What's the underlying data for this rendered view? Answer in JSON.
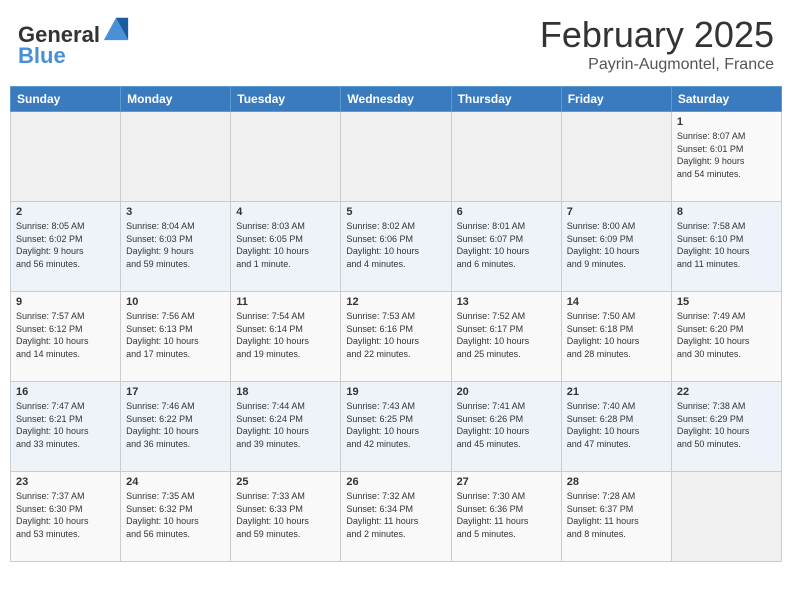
{
  "header": {
    "logo_general": "General",
    "logo_blue": "Blue",
    "month_title": "February 2025",
    "location": "Payrin-Augmontel, France"
  },
  "weekdays": [
    "Sunday",
    "Monday",
    "Tuesday",
    "Wednesday",
    "Thursday",
    "Friday",
    "Saturday"
  ],
  "weeks": [
    [
      {
        "day": "",
        "info": ""
      },
      {
        "day": "",
        "info": ""
      },
      {
        "day": "",
        "info": ""
      },
      {
        "day": "",
        "info": ""
      },
      {
        "day": "",
        "info": ""
      },
      {
        "day": "",
        "info": ""
      },
      {
        "day": "1",
        "info": "Sunrise: 8:07 AM\nSunset: 6:01 PM\nDaylight: 9 hours\nand 54 minutes."
      }
    ],
    [
      {
        "day": "2",
        "info": "Sunrise: 8:05 AM\nSunset: 6:02 PM\nDaylight: 9 hours\nand 56 minutes."
      },
      {
        "day": "3",
        "info": "Sunrise: 8:04 AM\nSunset: 6:03 PM\nDaylight: 9 hours\nand 59 minutes."
      },
      {
        "day": "4",
        "info": "Sunrise: 8:03 AM\nSunset: 6:05 PM\nDaylight: 10 hours\nand 1 minute."
      },
      {
        "day": "5",
        "info": "Sunrise: 8:02 AM\nSunset: 6:06 PM\nDaylight: 10 hours\nand 4 minutes."
      },
      {
        "day": "6",
        "info": "Sunrise: 8:01 AM\nSunset: 6:07 PM\nDaylight: 10 hours\nand 6 minutes."
      },
      {
        "day": "7",
        "info": "Sunrise: 8:00 AM\nSunset: 6:09 PM\nDaylight: 10 hours\nand 9 minutes."
      },
      {
        "day": "8",
        "info": "Sunrise: 7:58 AM\nSunset: 6:10 PM\nDaylight: 10 hours\nand 11 minutes."
      }
    ],
    [
      {
        "day": "9",
        "info": "Sunrise: 7:57 AM\nSunset: 6:12 PM\nDaylight: 10 hours\nand 14 minutes."
      },
      {
        "day": "10",
        "info": "Sunrise: 7:56 AM\nSunset: 6:13 PM\nDaylight: 10 hours\nand 17 minutes."
      },
      {
        "day": "11",
        "info": "Sunrise: 7:54 AM\nSunset: 6:14 PM\nDaylight: 10 hours\nand 19 minutes."
      },
      {
        "day": "12",
        "info": "Sunrise: 7:53 AM\nSunset: 6:16 PM\nDaylight: 10 hours\nand 22 minutes."
      },
      {
        "day": "13",
        "info": "Sunrise: 7:52 AM\nSunset: 6:17 PM\nDaylight: 10 hours\nand 25 minutes."
      },
      {
        "day": "14",
        "info": "Sunrise: 7:50 AM\nSunset: 6:18 PM\nDaylight: 10 hours\nand 28 minutes."
      },
      {
        "day": "15",
        "info": "Sunrise: 7:49 AM\nSunset: 6:20 PM\nDaylight: 10 hours\nand 30 minutes."
      }
    ],
    [
      {
        "day": "16",
        "info": "Sunrise: 7:47 AM\nSunset: 6:21 PM\nDaylight: 10 hours\nand 33 minutes."
      },
      {
        "day": "17",
        "info": "Sunrise: 7:46 AM\nSunset: 6:22 PM\nDaylight: 10 hours\nand 36 minutes."
      },
      {
        "day": "18",
        "info": "Sunrise: 7:44 AM\nSunset: 6:24 PM\nDaylight: 10 hours\nand 39 minutes."
      },
      {
        "day": "19",
        "info": "Sunrise: 7:43 AM\nSunset: 6:25 PM\nDaylight: 10 hours\nand 42 minutes."
      },
      {
        "day": "20",
        "info": "Sunrise: 7:41 AM\nSunset: 6:26 PM\nDaylight: 10 hours\nand 45 minutes."
      },
      {
        "day": "21",
        "info": "Sunrise: 7:40 AM\nSunset: 6:28 PM\nDaylight: 10 hours\nand 47 minutes."
      },
      {
        "day": "22",
        "info": "Sunrise: 7:38 AM\nSunset: 6:29 PM\nDaylight: 10 hours\nand 50 minutes."
      }
    ],
    [
      {
        "day": "23",
        "info": "Sunrise: 7:37 AM\nSunset: 6:30 PM\nDaylight: 10 hours\nand 53 minutes."
      },
      {
        "day": "24",
        "info": "Sunrise: 7:35 AM\nSunset: 6:32 PM\nDaylight: 10 hours\nand 56 minutes."
      },
      {
        "day": "25",
        "info": "Sunrise: 7:33 AM\nSunset: 6:33 PM\nDaylight: 10 hours\nand 59 minutes."
      },
      {
        "day": "26",
        "info": "Sunrise: 7:32 AM\nSunset: 6:34 PM\nDaylight: 11 hours\nand 2 minutes."
      },
      {
        "day": "27",
        "info": "Sunrise: 7:30 AM\nSunset: 6:36 PM\nDaylight: 11 hours\nand 5 minutes."
      },
      {
        "day": "28",
        "info": "Sunrise: 7:28 AM\nSunset: 6:37 PM\nDaylight: 11 hours\nand 8 minutes."
      },
      {
        "day": "",
        "info": ""
      }
    ]
  ]
}
